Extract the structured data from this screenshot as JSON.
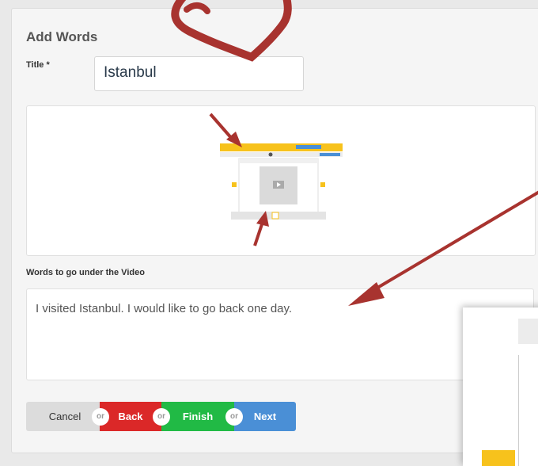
{
  "form": {
    "section_title": "Add Words",
    "title_label": "Title *",
    "title_value": "Istanbul",
    "words_label": "Words to go under the Video",
    "words_value": "I visited Istanbul. I would like to go back one day."
  },
  "buttons": {
    "cancel": "Cancel",
    "back": "Back",
    "finish": "Finish",
    "next": "Next",
    "or": "or"
  },
  "colors": {
    "back": "#db2828",
    "finish": "#21ba45",
    "next": "#4a8fd6",
    "annotation": "#a8332f",
    "highlight": "#f7c21c"
  }
}
